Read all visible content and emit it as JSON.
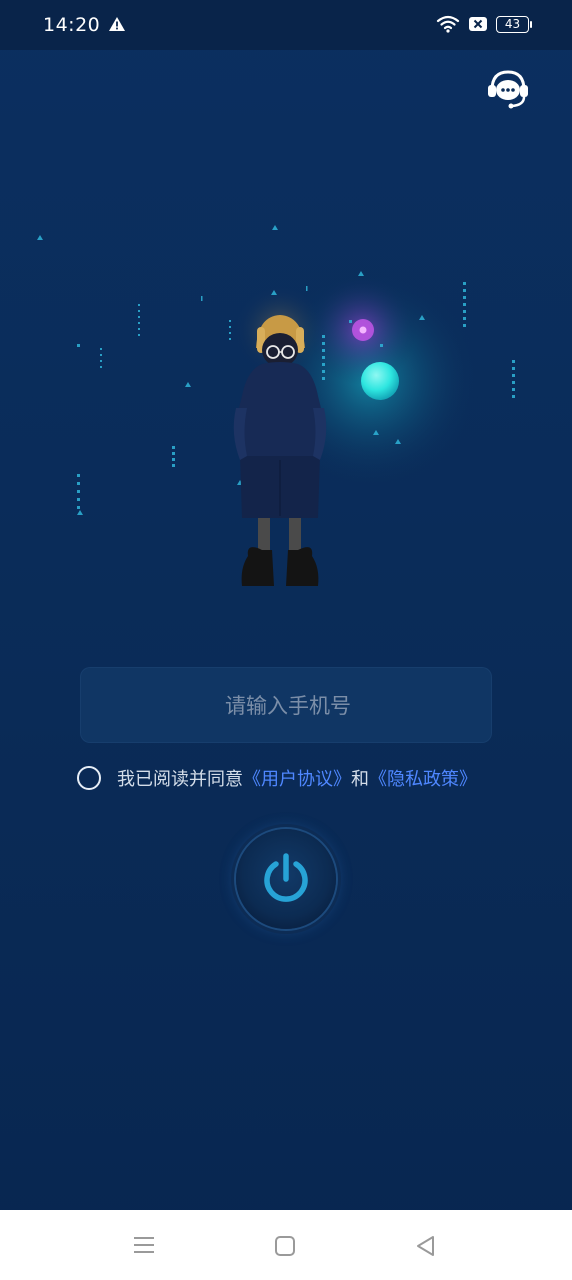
{
  "status_bar": {
    "time": "14:20",
    "battery_level": "43",
    "icons": [
      "warning-icon",
      "wifi-icon",
      "no-sim-icon",
      "battery-icon"
    ]
  },
  "header": {
    "support_icon": "customer-service-icon"
  },
  "login": {
    "phone_placeholder": "请输入手机号",
    "phone_value": "",
    "agreement_prefix": "我已阅读并同意",
    "user_agreement_link": "《用户协议》",
    "agreement_and": "和",
    "privacy_policy_link": "《隐私政策》",
    "agreement_checked": false,
    "submit_icon": "power-icon"
  },
  "navigation_bar": {
    "icons": [
      "menu-icon",
      "home-icon",
      "back-icon"
    ]
  },
  "colors": {
    "background": "#0a2b57",
    "status_bar": "#09244a",
    "link": "#4f87ff",
    "accent_cyan": "#2ee6e0",
    "accent_purple": "#b84de0",
    "power_icon": "#27a3d6"
  }
}
